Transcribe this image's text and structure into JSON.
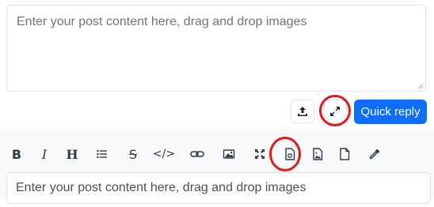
{
  "composer": {
    "placeholder": "Enter your post content here, drag and drop images"
  },
  "actions": {
    "upload_icon": "upload-icon",
    "expand_icon": "expand-icon",
    "quick_reply_label": "Quick reply"
  },
  "toolbar": {
    "items": [
      {
        "name": "bold",
        "glyph": "B"
      },
      {
        "name": "italic",
        "glyph": "I"
      },
      {
        "name": "heading",
        "glyph": "H"
      },
      {
        "name": "list",
        "glyph": "list-icon"
      },
      {
        "name": "strikethrough",
        "glyph": "S"
      },
      {
        "name": "code",
        "glyph": "</>"
      },
      {
        "name": "link",
        "glyph": "link-icon"
      },
      {
        "name": "image",
        "glyph": "image-icon"
      },
      {
        "name": "fullscreen",
        "glyph": "arrows-icon"
      },
      {
        "name": "zip-file",
        "glyph": "file-zip-icon"
      },
      {
        "name": "image-file",
        "glyph": "file-image-icon"
      },
      {
        "name": "file",
        "glyph": "file-icon"
      },
      {
        "name": "color-picker",
        "glyph": "eyedropper-icon"
      }
    ]
  },
  "lower_composer": {
    "placeholder": "Enter your post content here, drag and drop images"
  },
  "colors": {
    "primary": "#0d6efd",
    "annotation_red": "#e0191b",
    "border": "#dee2e6"
  }
}
